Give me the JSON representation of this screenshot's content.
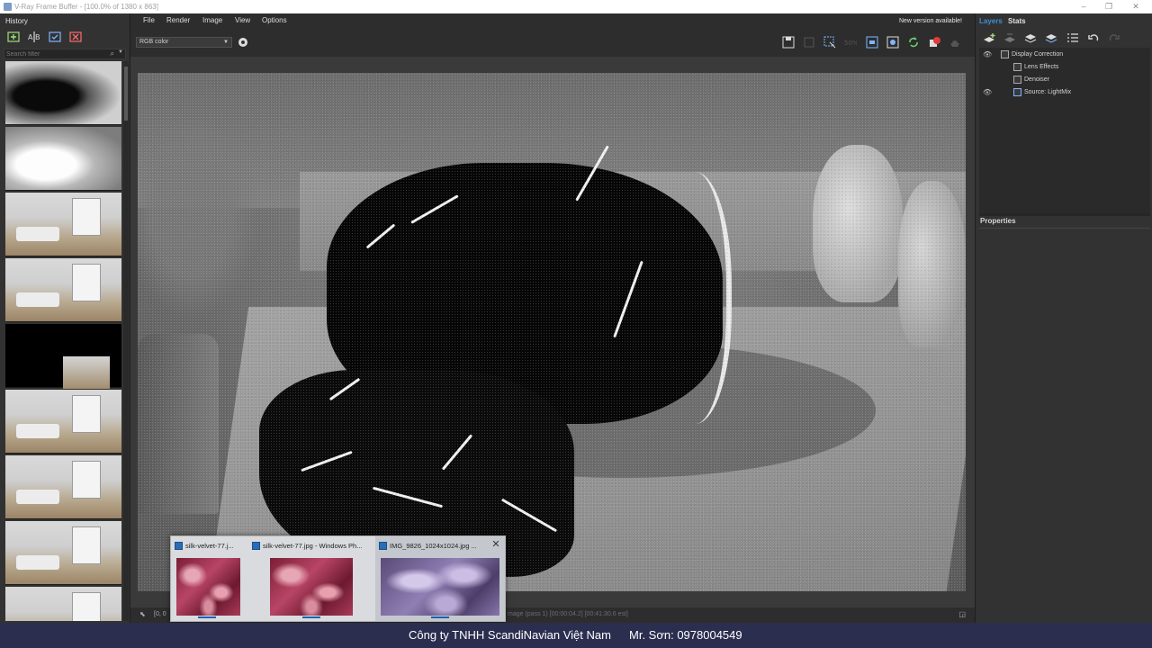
{
  "window": {
    "title": "V-Ray Frame Buffer - [100.0% of 1380 x 863]"
  },
  "history_panel": {
    "title": "History",
    "filter_placeholder": "Search filter",
    "thumbnails": [
      "dark-pouf",
      "white-pouf",
      "room",
      "room",
      "black-with-inset",
      "room",
      "room",
      "room",
      "room"
    ]
  },
  "menu": {
    "items": [
      "File",
      "Render",
      "Image",
      "View",
      "Options"
    ],
    "notice": "New version available!"
  },
  "toolbar": {
    "channel": "RGB color"
  },
  "status": {
    "coords": "[0, 0",
    "pass_info": "mage (pass 1) [00:00:04.2] [00:41:30.6 est]"
  },
  "right_panel": {
    "tabs": [
      "Layers",
      "Stats"
    ],
    "layers": [
      {
        "name": "Display Correction",
        "visible": true
      },
      {
        "name": "Lens Effects",
        "visible": false
      },
      {
        "name": "Denoiser",
        "visible": false
      },
      {
        "name": "Source: LightMix",
        "visible": true
      }
    ],
    "properties_title": "Properties"
  },
  "taskbar_preview": {
    "cards": [
      {
        "title": "silk-velvet-77.j...",
        "image": "red velvet"
      },
      {
        "title": "silk-velvet-77.jpg - Windows Ph...",
        "image": "red velvet"
      },
      {
        "title": "IMG_9826_1024x1024.jpg ...",
        "image": "purple velvet"
      }
    ]
  },
  "footer": {
    "company": "Công ty TNHH ScandiNavian Việt Nam",
    "contact": "Mr. Sơn: 0978004549"
  },
  "colors": {
    "accent_blue": "#1d62b4",
    "footer_bg": "#2b2e4f",
    "panel_bg": "#323232",
    "layers_tab": "#3d8fd6"
  }
}
